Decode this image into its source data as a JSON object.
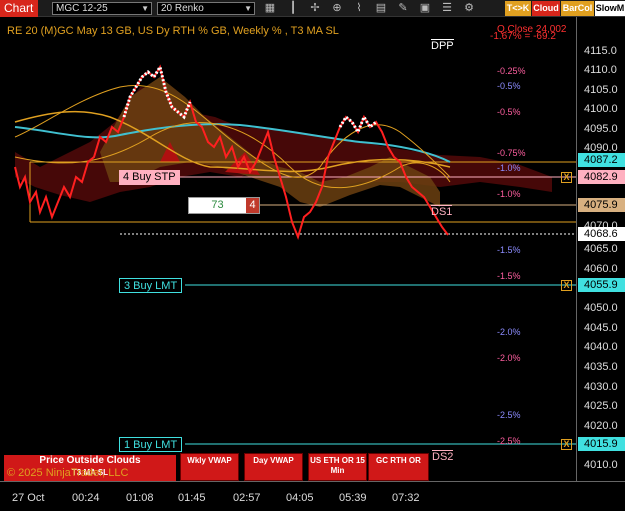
{
  "toolbar": {
    "tab_label": "Chart",
    "instrument": "MGC 12-25",
    "bar_type": "20 Renko",
    "icons": [
      "calendar-icon",
      "chart-style-icon",
      "crosshair-icon",
      "zoom-icon",
      "indicators-icon",
      "strategies-icon",
      "draw-icon",
      "properties-icon",
      "list-icon",
      "properties-gear-icon"
    ],
    "tk_label": "T<>K",
    "cloud_label": "Cloud",
    "barcol_label": "BarCol",
    "slowm_label": "SlowM",
    "colors": {
      "tab": "#d7261b",
      "tk": "#e0a020",
      "cloud": "#d7261b",
      "barcol": "#e0a020"
    }
  },
  "header": {
    "title": "RE 20  (M)GC May 13 GB, US Dy RTH % GB, Weekly % , T3 MA SL",
    "right_line1": "Q.Close 24,002",
    "right_line2": "-1.67% = -69.2",
    "dpp_label": "DPP",
    "ds1_label": "DS1",
    "ds2_label": "DS2"
  },
  "percent_labels": [
    {
      "text": "-0.25%",
      "color": "#ff5fa0"
    },
    {
      "text": "-0.5%",
      "color": "#8c8cff"
    },
    {
      "text": "-0.5%",
      "color": "#ff5fa0"
    },
    {
      "text": "-0.75%",
      "color": "#ff5fa0"
    },
    {
      "text": "-1.0%",
      "color": "#8c8cff"
    },
    {
      "text": "-1.0%",
      "color": "#ff5fa0"
    },
    {
      "text": "-1.5%",
      "color": "#8c8cff"
    },
    {
      "text": "-1.5%",
      "color": "#ff5fa0"
    },
    {
      "text": "-2.0%",
      "color": "#8c8cff"
    },
    {
      "text": "-2.0%",
      "color": "#ff5fa0"
    },
    {
      "text": "-2.5%",
      "color": "#8c8cff"
    },
    {
      "text": "-2.5%",
      "color": "#ff5fa0"
    }
  ],
  "orders": {
    "buy_stp": {
      "label": "4 Buy STP",
      "price": "4082.9"
    },
    "buy_lmt3": {
      "label": "3 Buy LMT",
      "price": "4055.9"
    },
    "buy_lmt1": {
      "label": "1 Buy LMT",
      "price": "4015.9"
    },
    "close_x": "X"
  },
  "position": {
    "quantity": "73",
    "orders": "4"
  },
  "price_axis": {
    "ticks": [
      "4115.0",
      "4110.0",
      "4105.0",
      "4100.0",
      "4095.0",
      "4090.0",
      "4085.0",
      "4080.0",
      "4070.0",
      "4065.0",
      "4060.0",
      "4050.0",
      "4045.0",
      "4040.0",
      "4035.0",
      "4030.0",
      "4025.0",
      "4020.0",
      "4010.0"
    ],
    "badge_upper": "4087.2",
    "badge_stp": "4082.9",
    "badge_pos": "4075.9",
    "badge_last": "4068.6",
    "badge_lmt3": "4055.9",
    "badge_lmt1": "4015.9",
    "colors": {
      "cyan": "#40e0e0",
      "pink": "#ffb0c0",
      "tan": "#d8b080",
      "white": "#ffffff"
    }
  },
  "time_axis": {
    "labels": [
      "27 Oct",
      "00:24",
      "01:08",
      "01:45",
      "02:57",
      "04:05",
      "05:39",
      "07:32"
    ]
  },
  "bottom_buttons": {
    "price_clouds": "Price Outside Clouds",
    "price_clouds_sub": "T3 MA SL",
    "wkly_vwap": "Wkly VWAP",
    "day_vwap": "Day VWAP",
    "us_eth": "US ETH OR 15 Min",
    "gc_rth": "GC RTH OR"
  },
  "copyright": "© 2025 NinjaTrader, LLC"
}
